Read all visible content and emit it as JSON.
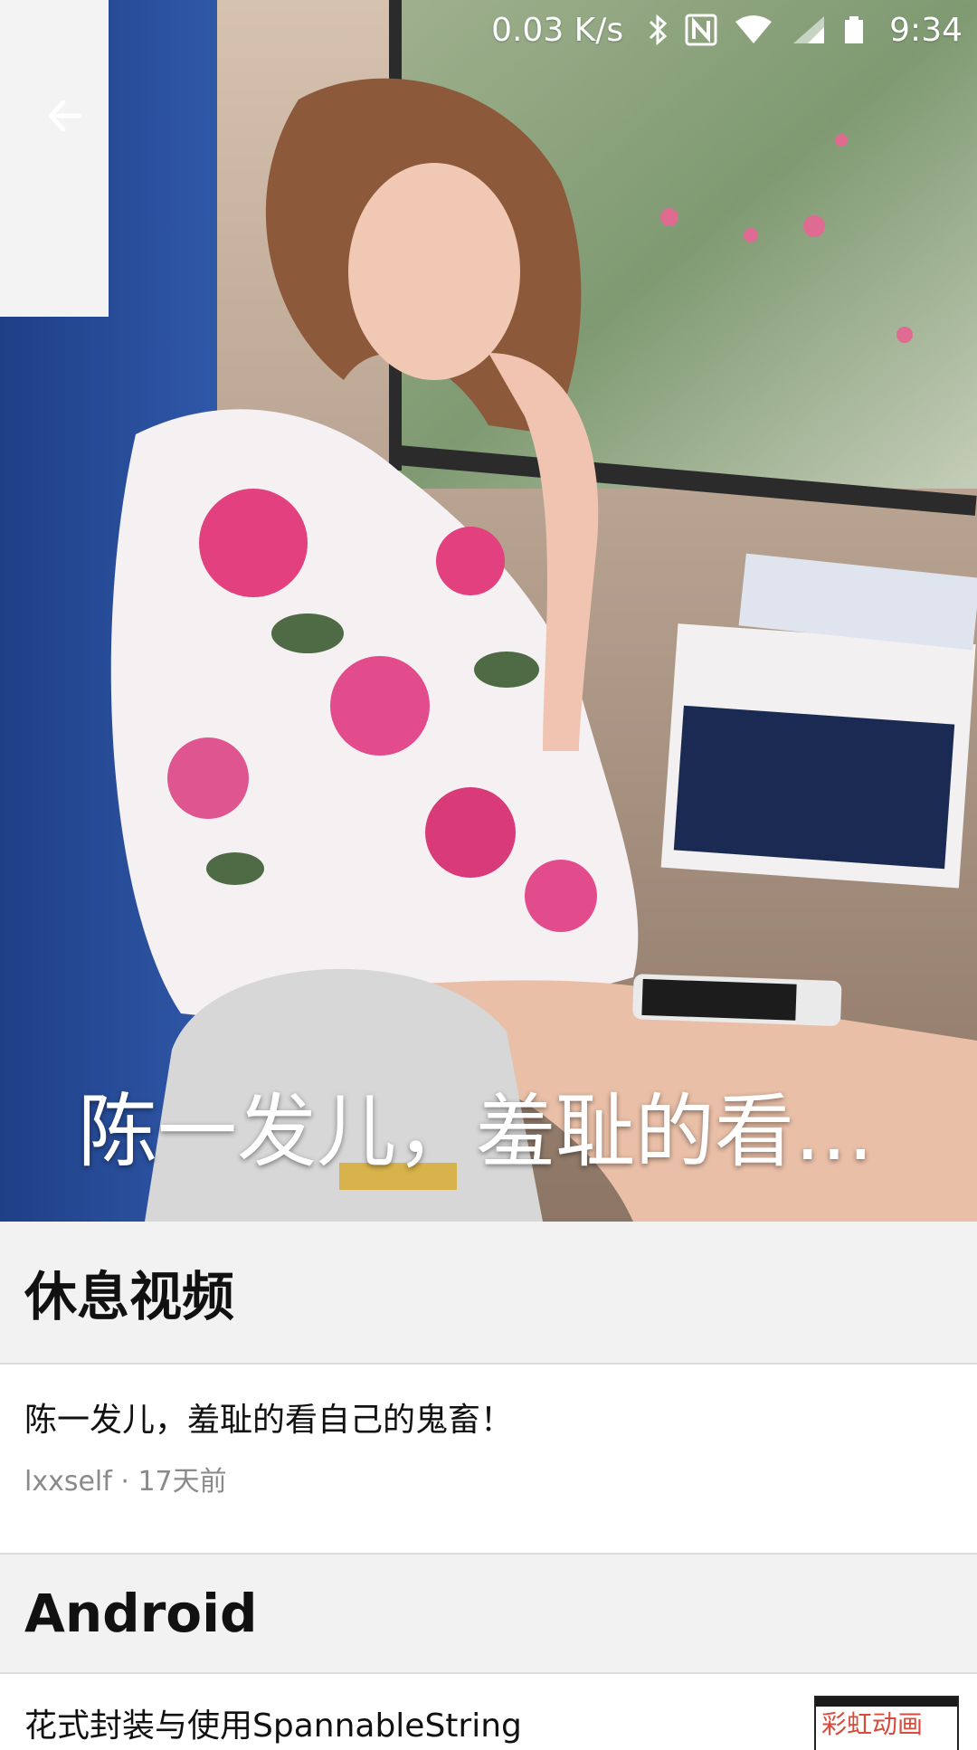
{
  "status_bar": {
    "network_speed": "0.03 K/s",
    "time": "9:34",
    "icons": [
      "bluetooth-icon",
      "nfc-icon",
      "wifi-icon",
      "mobile-signal-icon",
      "battery-icon"
    ]
  },
  "hero": {
    "back_icon": "arrow-left-icon",
    "title": "陈一发儿，羞耻的看…"
  },
  "sections": [
    {
      "header": "休息视频",
      "items": [
        {
          "title": "陈一发儿，羞耻的看自己的鬼畜！",
          "author": "lxxself",
          "separator": " · ",
          "time_ago": "17天前"
        }
      ]
    },
    {
      "header": "Android",
      "items": [
        {
          "title": "花式封装与使用SpannableString",
          "thumbnail_label": "彩虹动画"
        }
      ]
    }
  ],
  "colors": {
    "section_bg": "#f2f2f2",
    "meta_text": "#8a8a8a",
    "title_text": "#111111"
  }
}
